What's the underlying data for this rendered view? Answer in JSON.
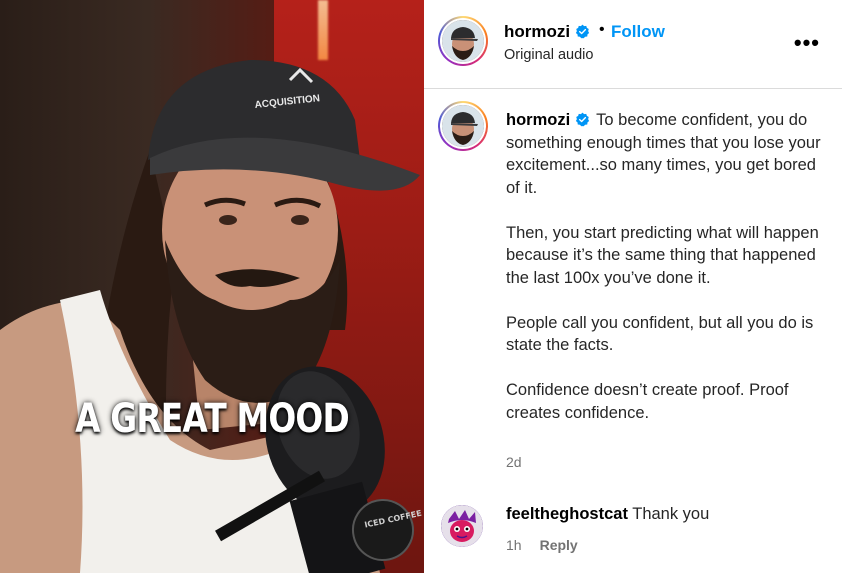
{
  "video": {
    "overlay_caption": "A GREAT MOOD",
    "cap_logo_text": "ACQUISITION",
    "mic_sticker_text": "ICED COFFEE HOUR"
  },
  "header": {
    "username": "hormozi",
    "separator": "•",
    "follow_label": "Follow",
    "audio_label": "Original audio",
    "more_icon": "more-horizontal-icon",
    "more_glyph": "•••"
  },
  "post": {
    "username": "hormozi",
    "caption_paragraphs": [
      "To become confident, you do something enough times that you lose your excitement...so many times, you get bored of it.",
      "Then, you start predicting what will happen because it’s the same thing that happened the last 100x you’ve done it.",
      "People call you confident, but all you do is state the facts.",
      "Confidence doesn’t create proof. Proof creates confidence."
    ],
    "age": "2d"
  },
  "comment": {
    "username": "feeltheghostcat",
    "text": "Thank you",
    "age": "1h",
    "reply_label": "Reply"
  },
  "colors": {
    "accent_blue": "#0095f6",
    "verified_blue": "#0095f6",
    "muted": "#737373",
    "divider": "#dbdbdb"
  }
}
